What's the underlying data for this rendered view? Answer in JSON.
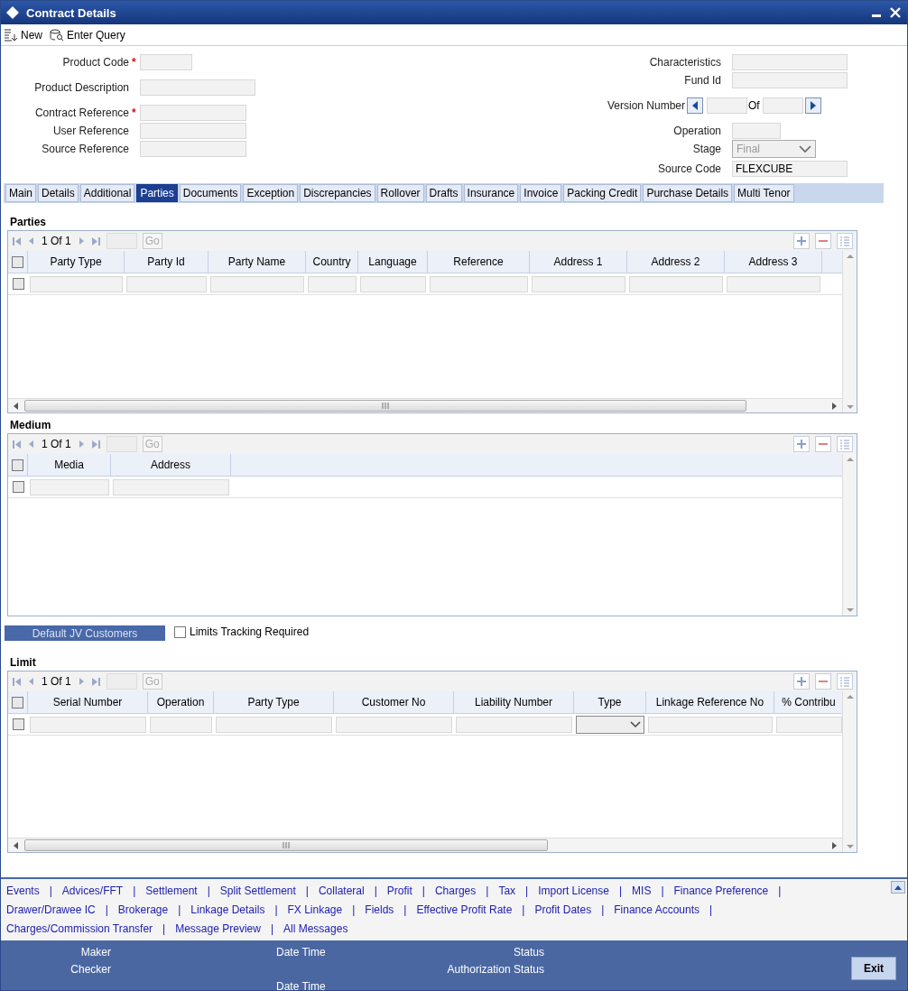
{
  "window": {
    "title": "Contract Details"
  },
  "toolbar": [
    {
      "kind": "new",
      "label": "New"
    },
    {
      "kind": "query",
      "label": "Enter Query"
    }
  ],
  "header": {
    "left": [
      {
        "label": "Product Code",
        "required": true
      },
      {
        "label": "Product Description",
        "required": false
      },
      {
        "label": "Contract Reference",
        "required": true
      },
      {
        "label": "User Reference",
        "required": false
      },
      {
        "label": "Source Reference",
        "required": false
      }
    ],
    "right": [
      {
        "kind": "text",
        "label": "Characteristics"
      },
      {
        "kind": "text",
        "label": "Fund Id"
      },
      {
        "kind": "version",
        "label": "Version Number",
        "of": "Of"
      },
      {
        "kind": "short",
        "label": "Operation"
      },
      {
        "kind": "select",
        "label": "Stage",
        "value": "Final",
        "disabled": true
      },
      {
        "kind": "text",
        "label": "Source Code",
        "value": "FLEXCUBE"
      }
    ],
    "required_mark": "*"
  },
  "tabs": [
    {
      "label": "Main",
      "selected": false
    },
    {
      "label": "Details",
      "selected": false
    },
    {
      "label": "Additional",
      "selected": false
    },
    {
      "label": "Parties",
      "selected": true
    },
    {
      "label": "Documents",
      "selected": false
    },
    {
      "label": "Exception",
      "selected": false
    },
    {
      "label": "Discrepancies",
      "selected": false
    },
    {
      "label": "Rollover",
      "selected": false
    },
    {
      "label": "Drafts",
      "selected": false
    },
    {
      "label": "Insurance",
      "selected": false
    },
    {
      "label": "Invoice",
      "selected": false
    },
    {
      "label": "Packing Credit",
      "selected": false
    },
    {
      "label": "Purchase Details",
      "selected": false
    },
    {
      "label": "Multi Tenor",
      "selected": false
    }
  ],
  "grids": [
    {
      "title": "Parties",
      "pager": {
        "page": "1",
        "of": "Of",
        "total": "1",
        "go": "Go"
      },
      "all_checked": false,
      "horizontal_scroll": true,
      "columns": [
        {
          "label": "Party Type",
          "kind": "text"
        },
        {
          "label": "Party Id",
          "kind": "text"
        },
        {
          "label": "Party Name",
          "kind": "text"
        },
        {
          "label": "Country",
          "kind": "text"
        },
        {
          "label": "Language",
          "kind": "text"
        },
        {
          "label": "Reference",
          "kind": "text"
        },
        {
          "label": "Address 1",
          "kind": "text"
        },
        {
          "label": "Address 2",
          "kind": "text"
        },
        {
          "label": "Address 3",
          "kind": "text"
        }
      ],
      "rows": [
        {
          "checked": false
        }
      ]
    },
    {
      "title": "Medium",
      "pager": {
        "page": "1",
        "of": "Of",
        "total": "1",
        "go": "Go"
      },
      "all_checked": false,
      "horizontal_scroll": false,
      "columns": [
        {
          "label": "Media",
          "kind": "text"
        },
        {
          "label": "Address",
          "kind": "text"
        }
      ],
      "rows": [
        {
          "checked": false
        }
      ]
    },
    {
      "title": "Limit",
      "pager": {
        "page": "1",
        "of": "Of",
        "total": "1",
        "go": "Go"
      },
      "all_checked": false,
      "horizontal_scroll": true,
      "columns": [
        {
          "label": "Serial Number",
          "kind": "text"
        },
        {
          "label": "Operation",
          "kind": "text"
        },
        {
          "label": "Party Type",
          "kind": "text"
        },
        {
          "label": "Customer No",
          "kind": "text"
        },
        {
          "label": "Liability Number",
          "kind": "text"
        },
        {
          "label": "Type",
          "kind": "select"
        },
        {
          "label": "Linkage Reference No",
          "kind": "text"
        },
        {
          "label": "% Contribu",
          "kind": "text"
        }
      ],
      "rows": [
        {
          "checked": false
        }
      ]
    }
  ],
  "jv_button": "Default JV Customers",
  "limits_tracking": {
    "label": "Limits Tracking Required",
    "checked": false
  },
  "link_separator": "|",
  "link_rows": [
    [
      {
        "label": "Events",
        "bar": true
      },
      {
        "label": "Advices/FFT",
        "bar": true
      },
      {
        "label": "Settlement",
        "bar": true
      },
      {
        "label": "Split Settlement",
        "bar": true
      },
      {
        "label": "Collateral",
        "bar": true
      },
      {
        "label": "Profit",
        "bar": true
      },
      {
        "label": "Charges",
        "bar": true
      },
      {
        "label": "Tax",
        "bar": true
      },
      {
        "label": "Import License",
        "bar": true
      },
      {
        "label": "MIS",
        "bar": true
      },
      {
        "label": "Finance Preference",
        "bar": true
      }
    ],
    [
      {
        "label": "Drawer/Drawee IC",
        "bar": true
      },
      {
        "label": "Brokerage",
        "bar": true
      },
      {
        "label": "Linkage Details",
        "bar": true
      },
      {
        "label": "FX Linkage",
        "bar": true
      },
      {
        "label": "Fields",
        "bar": true
      },
      {
        "label": "Effective Profit Rate",
        "bar": true
      },
      {
        "label": "Profit Dates",
        "bar": true
      },
      {
        "label": "Finance Accounts",
        "bar": true
      }
    ],
    [
      {
        "label": "Charges/Commission Transfer",
        "bar": true
      },
      {
        "label": "Message Preview",
        "bar": true
      },
      {
        "label": "All Messages",
        "bar": false
      }
    ]
  ],
  "footer": {
    "maker": "Maker",
    "checker": "Checker",
    "maker_date": "Date Time",
    "checker_date": "Date Time",
    "status": "Status",
    "auth_status": "Authorization Status",
    "exit": "Exit"
  }
}
